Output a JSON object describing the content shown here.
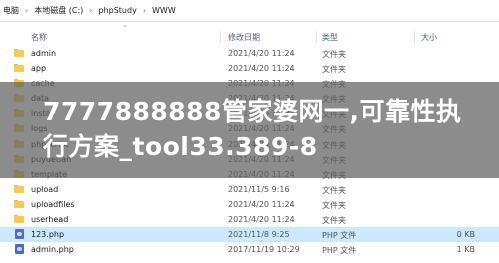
{
  "breadcrumb": {
    "items": [
      "电脑",
      "本地磁盘 (C:)",
      "phpStudy",
      "WWW"
    ],
    "separator": "›"
  },
  "columns": {
    "name": "名称",
    "date": "修改日期",
    "type": "类型",
    "size": "大小"
  },
  "rows": [
    {
      "name": "admin",
      "date": "2021/4/20 11:24",
      "type": "文件夹",
      "size": "",
      "icon": "folder-icon"
    },
    {
      "name": "app",
      "date": "2021/4/20 11:24",
      "type": "文件夹",
      "size": "",
      "icon": "folder-icon"
    },
    {
      "name": "cache",
      "date": "2021/4/20 11:24",
      "type": "文件夹",
      "size": "",
      "icon": "folder-icon"
    },
    {
      "name": "data",
      "date": "2021/4/20 11:24",
      "type": "文件夹",
      "size": "",
      "icon": "folder-icon"
    },
    {
      "name": "install",
      "date": "2021/4/20 11:24",
      "type": "文件夹",
      "size": "",
      "icon": "folder-icon"
    },
    {
      "name": "logs",
      "date": "2021/4/20 11:24",
      "type": "文件夹",
      "size": "",
      "icon": "folder-icon"
    },
    {
      "name": "phpscript",
      "date": "2021/4/20 11:24",
      "type": "文件夹",
      "size": "",
      "icon": "folder-icon"
    },
    {
      "name": "puyuetian",
      "date": "2021/4/20 11:24",
      "type": "文件夹",
      "size": "",
      "icon": "folder-icon"
    },
    {
      "name": "template",
      "date": "2021/4/20 11:24",
      "type": "文件夹",
      "size": "",
      "icon": "folder-icon"
    },
    {
      "name": "upload",
      "date": "2021/11/5 9:16",
      "type": "文件夹",
      "size": "",
      "icon": "folder-icon"
    },
    {
      "name": "uploadfiles",
      "date": "2021/4/20 11:24",
      "type": "文件夹",
      "size": "",
      "icon": "folder-icon"
    },
    {
      "name": "userhead",
      "date": "2021/4/20 11:24",
      "type": "文件夹",
      "size": "",
      "icon": "folder-icon"
    },
    {
      "name": "123.php",
      "date": "2021/11/8 9:25",
      "type": "PHP 文件",
      "size": "0 KB",
      "icon": "php-file-icon",
      "selected": true
    },
    {
      "name": "admin.php",
      "date": "2017/11/19 10:29",
      "type": "PHP 文件",
      "size": "1 KB",
      "icon": "php-file-icon"
    }
  ],
  "overlay": {
    "text": "7777888888管家婆网一,可靠性执行方案_tool33.389-8"
  },
  "colors": {
    "selection": "#cce8ff",
    "folder": "#f6c95b",
    "header_text": "#4c607a"
  }
}
